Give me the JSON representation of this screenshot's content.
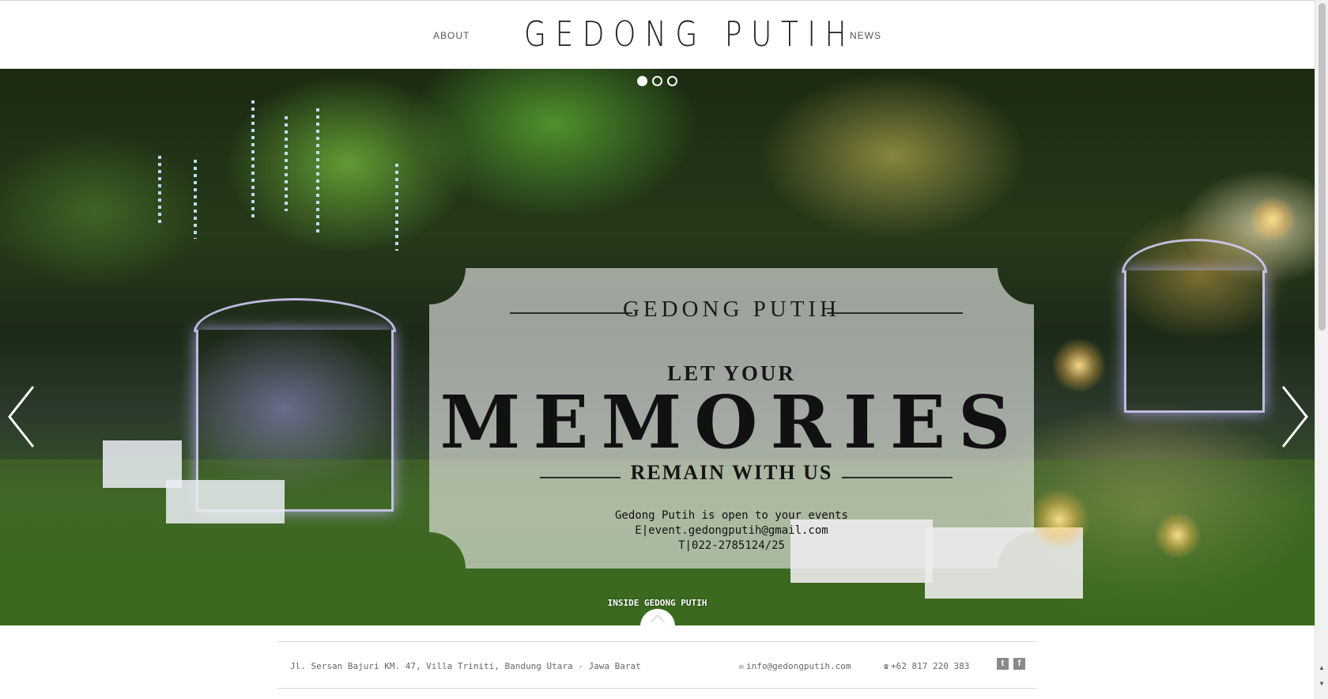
{
  "header": {
    "nav_left": "ABOUT",
    "logo": "GEDONG PUTIH",
    "nav_right": "NEWS"
  },
  "slider": {
    "slide_count": 3,
    "active_index": 0,
    "prev_icon": "chevron-left-icon",
    "next_icon": "chevron-right-icon"
  },
  "card": {
    "brand": "GEDONG PUTIH",
    "line1": "LET YOUR",
    "headline": "MEMORIES",
    "line2": "REMAIN WITH US",
    "info_line1": "Gedong Putih is open to your events",
    "info_line2": "E|event.gedongputih@gmail.com",
    "info_line3": "T|022-2785124/25"
  },
  "inside_label": "INSIDE GEDONG PUTIH",
  "footer": {
    "address": "Jl. Sersan Bajuri KM. 47, Villa Triniti, Bandung Utara - Jawa Barat",
    "email_icon": "mail-icon",
    "email": "info@gedongputih.com",
    "phone_icon": "phone-icon",
    "phone": "+62 817 220 383",
    "social": [
      "twitter-icon",
      "facebook-icon"
    ]
  },
  "colors": {
    "card_bg": "#e8e8e8",
    "text_dark": "#111111",
    "footer_text": "#666666"
  }
}
